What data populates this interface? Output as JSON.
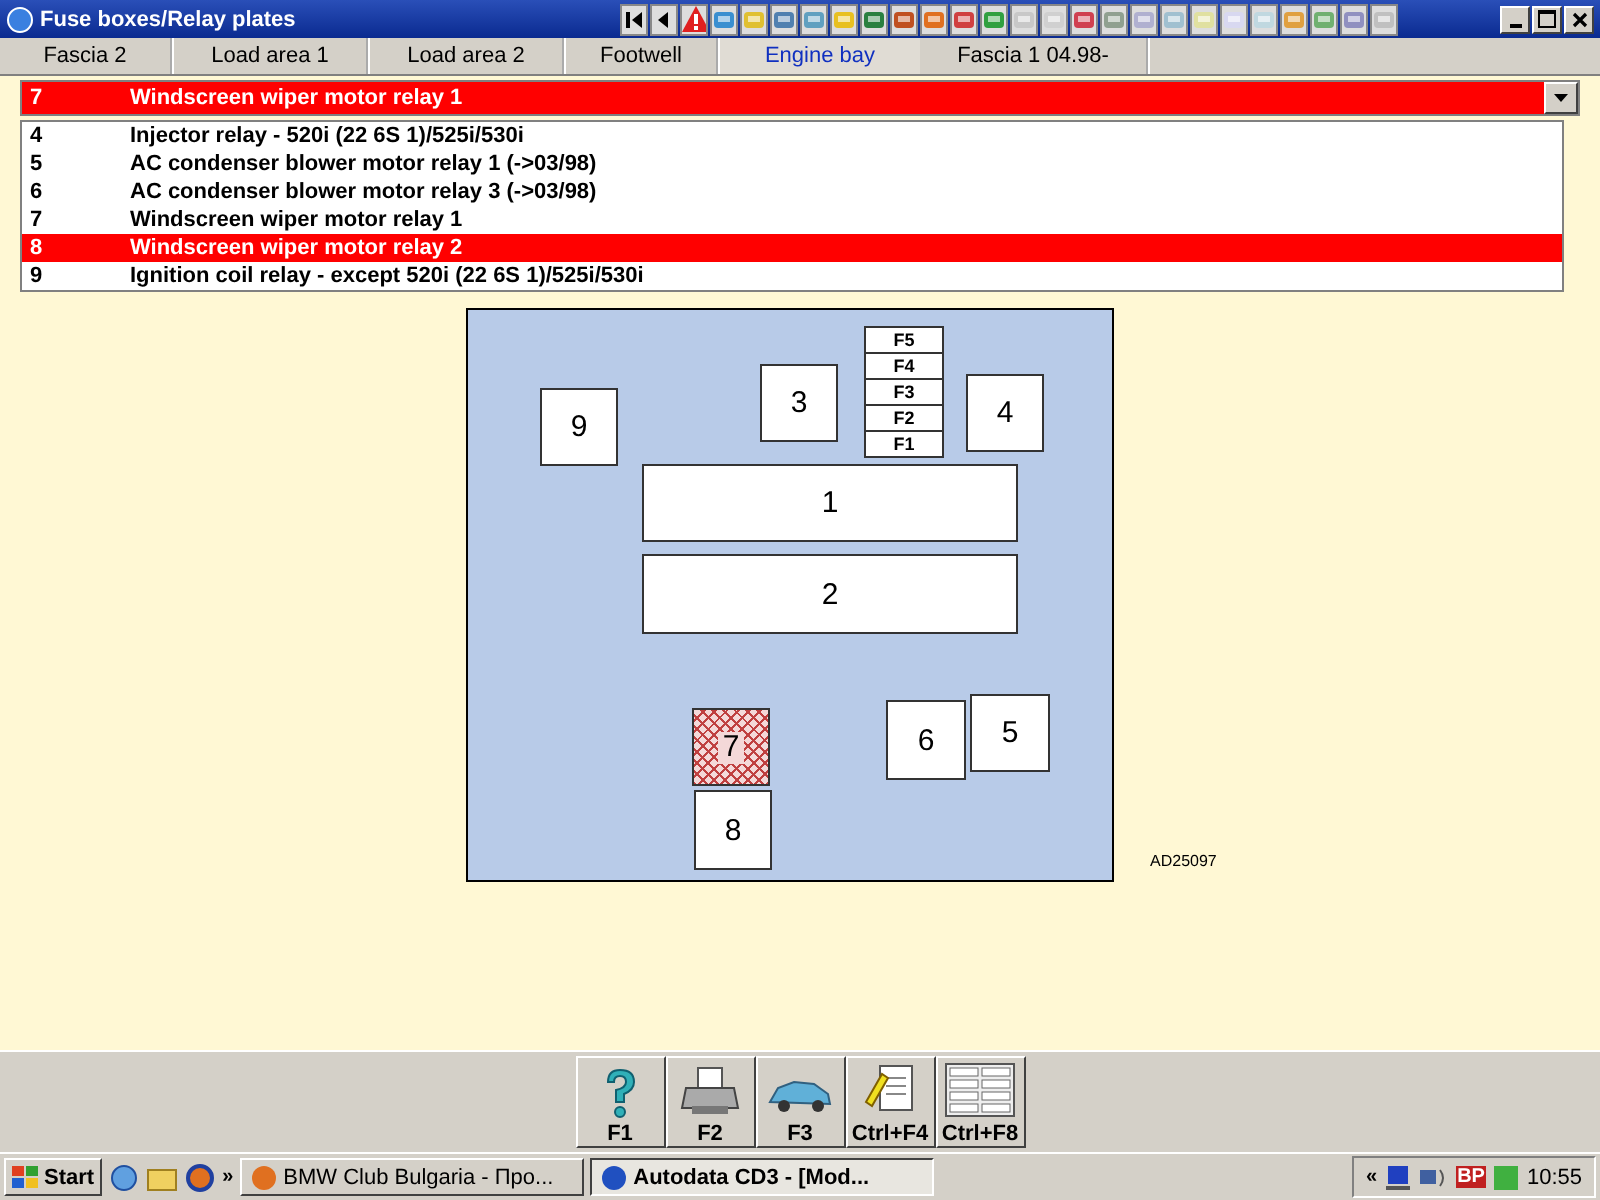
{
  "window": {
    "title": "Fuse boxes/Relay plates"
  },
  "tabs": [
    {
      "label": "Fascia 2",
      "selected": false
    },
    {
      "label": "Load area 1",
      "selected": false
    },
    {
      "label": "Load area 2",
      "selected": false
    },
    {
      "label": "Footwell",
      "selected": false
    },
    {
      "label": "Engine bay",
      "selected": true
    },
    {
      "label": "Fascia 1 04.98-",
      "selected": false
    }
  ],
  "dropdown": {
    "number": "7",
    "text": "Windscreen wiper motor relay 1"
  },
  "list": [
    {
      "number": "4",
      "text": "Injector relay - 520i (22 6S 1)/525i/530i",
      "selected": false
    },
    {
      "number": "5",
      "text": "AC condenser blower motor relay 1 (->03/98)",
      "selected": false
    },
    {
      "number": "6",
      "text": "AC condenser blower motor relay 3 (->03/98)",
      "selected": false
    },
    {
      "number": "7",
      "text": "Windscreen wiper motor relay 1",
      "selected": false
    },
    {
      "number": "8",
      "text": "Windscreen wiper motor relay 2",
      "selected": true
    },
    {
      "number": "9",
      "text": "Ignition coil relay - except 520i (22 6S 1)/525i/530i",
      "selected": false
    }
  ],
  "diagram": {
    "relays": [
      {
        "label": "9",
        "selected": false
      },
      {
        "label": "3",
        "selected": false
      },
      {
        "label": "4",
        "selected": false
      },
      {
        "label": "1",
        "selected": false
      },
      {
        "label": "2",
        "selected": false
      },
      {
        "label": "7",
        "selected": true
      },
      {
        "label": "8",
        "selected": false
      },
      {
        "label": "6",
        "selected": false
      },
      {
        "label": "5",
        "selected": false
      }
    ],
    "fuses": [
      "F5",
      "F4",
      "F3",
      "F2",
      "F1"
    ],
    "reference": "AD25097"
  },
  "function_buttons": [
    {
      "label": "F1",
      "kind": "help"
    },
    {
      "label": "F2",
      "kind": "print"
    },
    {
      "label": "F3",
      "kind": "car"
    },
    {
      "label": "Ctrl+F4",
      "kind": "notes"
    },
    {
      "label": "Ctrl+F8",
      "kind": "table"
    }
  ],
  "taskbar": {
    "start": "Start",
    "more": "»",
    "tasks": [
      {
        "label": "BMW Club Bulgaria - Про...",
        "selected": false
      },
      {
        "label": "Autodata CD3 - [Mod...",
        "selected": true
      }
    ],
    "tray_expand": "«",
    "tray_badge": "BP",
    "clock": "10:55"
  }
}
